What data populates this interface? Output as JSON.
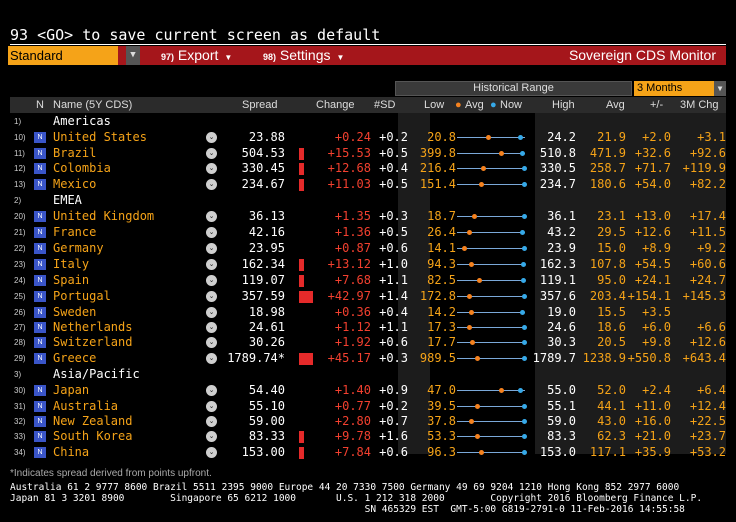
{
  "command_line": "93 <GO> to save current screen as default",
  "toolbar": {
    "view_select": "Standard",
    "export_num": "97)",
    "export_label": "Export",
    "settings_num": "98)",
    "settings_label": "Settings",
    "title": "Sovereign CDS Monitor"
  },
  "historical": {
    "label": "Historical Range",
    "selected": "3 Months"
  },
  "columns": {
    "n": "N",
    "name": "Name (5Y CDS)",
    "spread": "Spread",
    "change": "Change",
    "sd": "#SD",
    "low": "Low",
    "avg_legend": "Avg",
    "now_legend": "Now",
    "high": "High",
    "avg": "Avg",
    "pm": "+/-",
    "chg3m": "3M Chg"
  },
  "colors": {
    "accent_orange": "#f5a318",
    "toolbar_red": "#a5161b",
    "negative_red": "#f2402f",
    "badge_blue": "#3a55c8"
  },
  "rows": [
    {
      "kind": "group",
      "idx": "1)",
      "name": "Americas"
    },
    {
      "kind": "country",
      "idx": "10)",
      "name": "United States",
      "spread": "23.88",
      "bar": 0,
      "change": "+0.24",
      "sd": "+0.2",
      "low": "20.8",
      "range_avg": 0.45,
      "range_now": 0.92,
      "high": "24.2",
      "avg": "21.9",
      "pm": "+2.0",
      "chg": "+3.1"
    },
    {
      "kind": "country",
      "idx": "11)",
      "name": "Brazil",
      "spread": "504.53",
      "bar": 1,
      "change": "+15.53",
      "sd": "+0.5",
      "low": "399.8",
      "range_avg": 0.65,
      "range_now": 0.95,
      "high": "510.8",
      "avg": "471.9",
      "pm": "+32.6",
      "chg": "+92.6"
    },
    {
      "kind": "country",
      "idx": "12)",
      "name": "Colombia",
      "spread": "330.45",
      "bar": 1,
      "change": "+12.68",
      "sd": "+0.4",
      "low": "216.4",
      "range_avg": 0.38,
      "range_now": 0.98,
      "high": "330.5",
      "avg": "258.7",
      "pm": "+71.7",
      "chg": "+119.9"
    },
    {
      "kind": "country",
      "idx": "13)",
      "name": "Mexico",
      "spread": "234.67",
      "bar": 1,
      "change": "+11.03",
      "sd": "+0.5",
      "low": "151.4",
      "range_avg": 0.35,
      "range_now": 0.98,
      "high": "234.7",
      "avg": "180.6",
      "pm": "+54.0",
      "chg": "+82.2"
    },
    {
      "kind": "group",
      "idx": "2)",
      "name": "EMEA"
    },
    {
      "kind": "country",
      "idx": "20)",
      "name": "United Kingdom",
      "spread": "36.13",
      "bar": 0,
      "change": "+1.35",
      "sd": "+0.3",
      "low": "18.7",
      "range_avg": 0.25,
      "range_now": 0.98,
      "high": "36.1",
      "avg": "23.1",
      "pm": "+13.0",
      "chg": "+17.4"
    },
    {
      "kind": "country",
      "idx": "21)",
      "name": "France",
      "spread": "42.16",
      "bar": 0,
      "change": "+1.36",
      "sd": "+0.5",
      "low": "26.4",
      "range_avg": 0.18,
      "range_now": 0.95,
      "high": "43.2",
      "avg": "29.5",
      "pm": "+12.6",
      "chg": "+11.5"
    },
    {
      "kind": "country",
      "idx": "22)",
      "name": "Germany",
      "spread": "23.95",
      "bar": 0,
      "change": "+0.87",
      "sd": "+0.6",
      "low": "14.1",
      "range_avg": 0.1,
      "range_now": 0.98,
      "high": "23.9",
      "avg": "15.0",
      "pm": "+8.9",
      "chg": "+9.2"
    },
    {
      "kind": "country",
      "idx": "23)",
      "name": "Italy",
      "spread": "162.34",
      "bar": 1,
      "change": "+13.12",
      "sd": "+1.0",
      "low": "94.3",
      "range_avg": 0.2,
      "range_now": 0.97,
      "high": "162.3",
      "avg": "107.8",
      "pm": "+54.5",
      "chg": "+60.6"
    },
    {
      "kind": "country",
      "idx": "24)",
      "name": "Spain",
      "spread": "119.07",
      "bar": 1,
      "change": "+7.68",
      "sd": "+1.1",
      "low": "82.5",
      "range_avg": 0.33,
      "range_now": 0.97,
      "high": "119.1",
      "avg": "95.0",
      "pm": "+24.1",
      "chg": "+24.7"
    },
    {
      "kind": "country",
      "idx": "25)",
      "name": "Portugal",
      "spread": "357.59",
      "bar": 3,
      "change": "+42.97",
      "sd": "+1.4",
      "low": "172.8",
      "range_avg": 0.17,
      "range_now": 0.98,
      "high": "357.6",
      "avg": "203.4",
      "pm": "+154.1",
      "chg": "+145.3"
    },
    {
      "kind": "country",
      "idx": "26)",
      "name": "Sweden",
      "spread": "18.98",
      "bar": 0,
      "change": "+0.36",
      "sd": "+0.4",
      "low": "14.2",
      "range_avg": 0.2,
      "range_now": 0.95,
      "high": "19.0",
      "avg": "15.5",
      "pm": "+3.5",
      "chg": ""
    },
    {
      "kind": "country",
      "idx": "27)",
      "name": "Netherlands",
      "spread": "24.61",
      "bar": 0,
      "change": "+1.12",
      "sd": "+1.1",
      "low": "17.3",
      "range_avg": 0.18,
      "range_now": 0.98,
      "high": "24.6",
      "avg": "18.6",
      "pm": "+6.0",
      "chg": "+6.6"
    },
    {
      "kind": "country",
      "idx": "28)",
      "name": "Switzerland",
      "spread": "30.26",
      "bar": 0,
      "change": "+1.92",
      "sd": "+0.6",
      "low": "17.7",
      "range_avg": 0.22,
      "range_now": 0.98,
      "high": "30.3",
      "avg": "20.5",
      "pm": "+9.8",
      "chg": "+12.6"
    },
    {
      "kind": "country",
      "idx": "29)",
      "name": "Greece",
      "spread": "1789.74*",
      "bar": 3,
      "change": "+45.17",
      "sd": "+0.3",
      "low": "989.5",
      "range_avg": 0.3,
      "range_now": 0.98,
      "high": "1789.7",
      "avg": "1238.9",
      "pm": "+550.8",
      "chg": "+643.4"
    },
    {
      "kind": "group",
      "idx": "3)",
      "name": "Asia/Pacific"
    },
    {
      "kind": "country",
      "idx": "30)",
      "name": "Japan",
      "spread": "54.40",
      "bar": 0,
      "change": "+1.40",
      "sd": "+0.9",
      "low": "47.0",
      "range_avg": 0.65,
      "range_now": 0.93,
      "high": "55.0",
      "avg": "52.0",
      "pm": "+2.4",
      "chg": "+6.4"
    },
    {
      "kind": "country",
      "idx": "31)",
      "name": "Australia",
      "spread": "55.10",
      "bar": 0,
      "change": "+0.77",
      "sd": "+0.2",
      "low": "39.5",
      "range_avg": 0.3,
      "range_now": 0.98,
      "high": "55.1",
      "avg": "44.1",
      "pm": "+11.0",
      "chg": "+12.4"
    },
    {
      "kind": "country",
      "idx": "32)",
      "name": "New Zealand",
      "spread": "59.00",
      "bar": 0,
      "change": "+2.80",
      "sd": "+0.7",
      "low": "37.8",
      "range_avg": 0.2,
      "range_now": 0.98,
      "high": "59.0",
      "avg": "43.0",
      "pm": "+16.0",
      "chg": "+22.5"
    },
    {
      "kind": "country",
      "idx": "33)",
      "name": "South Korea",
      "spread": "83.33",
      "bar": 1,
      "change": "+9.78",
      "sd": "+1.6",
      "low": "53.3",
      "range_avg": 0.3,
      "range_now": 0.98,
      "high": "83.3",
      "avg": "62.3",
      "pm": "+21.0",
      "chg": "+23.7"
    },
    {
      "kind": "country",
      "idx": "34)",
      "name": "China",
      "spread": "153.00",
      "bar": 1,
      "change": "+7.84",
      "sd": "+0.6",
      "low": "96.3",
      "range_avg": 0.36,
      "range_now": 0.98,
      "high": "153.0",
      "avg": "117.1",
      "pm": "+35.9",
      "chg": "+53.2"
    }
  ],
  "footnote": "*Indicates spread derived from points upfront.",
  "footer": {
    "line1": "Australia 61 2 9777 8600 Brazil 5511 2395 9000 Europe 44 20 7330 7500 Germany 49 69 9204 1210 Hong Kong 852 2977 6000",
    "line2": "Japan 81 3 3201 8900        Singapore 65 6212 1000       U.S. 1 212 318 2000        Copyright 2016 Bloomberg Finance L.P.",
    "line3": "                                                              SN 465329 EST  GMT-5:00 G819-2791-0 11-Feb-2016 14:55:58"
  }
}
